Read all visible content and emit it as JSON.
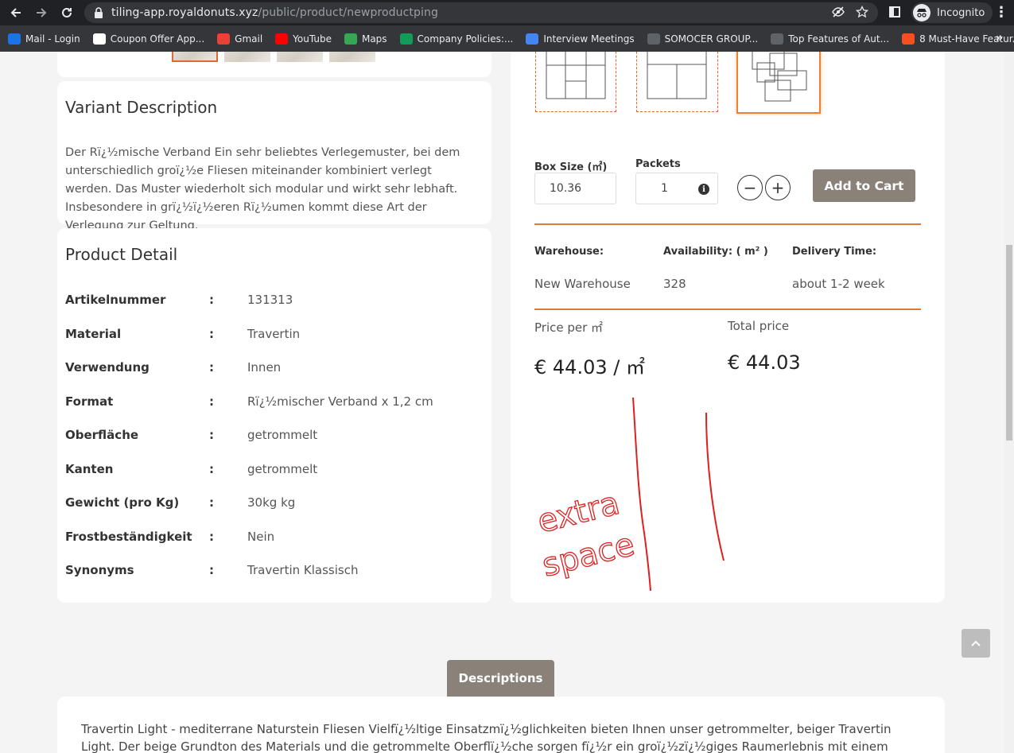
{
  "browser": {
    "url_host": "tiling-app.royaldonuts.xyz",
    "url_path": "/public/product/newproductping",
    "incognito_label": "Incognito"
  },
  "bookmarks": [
    {
      "label": "Mail - Login",
      "color": "#1a73e8"
    },
    {
      "label": "Coupon Offer App...",
      "color": "#ffffff"
    },
    {
      "label": "Gmail",
      "color": "#ea4335"
    },
    {
      "label": "YouTube",
      "color": "#ff0000"
    },
    {
      "label": "Maps",
      "color": "#34a853"
    },
    {
      "label": "Company Policies:...",
      "color": "#0f9d58"
    },
    {
      "label": "Interview Meetings",
      "color": "#4285f4"
    },
    {
      "label": "SOMOCER GROUP...",
      "color": "#5f6368"
    },
    {
      "label": "Top Features of Aut...",
      "color": "#5f6368"
    },
    {
      "label": "8 Must-Have Featur...",
      "color": "#f4511e"
    }
  ],
  "variant": {
    "title": "Variant Description",
    "text": "Der Rï¿½mische Verband Ein sehr beliebtes Verlegemuster, bei dem unterschiedlich groï¿½e Fliesen miteinander kombiniert verlegt werden. Das Muster wiederholt sich modular und wirkt sehr lebhaft. Insbesondere in grï¿½ï¿½eren Rï¿½umen kommt diese Art der Verlegung zur Geltung."
  },
  "detail": {
    "title": "Product Detail",
    "rows": [
      {
        "key": "Artikelnummer",
        "value": "131313"
      },
      {
        "key": "Material",
        "value": "Travertin"
      },
      {
        "key": "Verwendung",
        "value": "Innen"
      },
      {
        "key": "Format",
        "value": "Rï¿½mischer Verband x 1,2 cm"
      },
      {
        "key": "Oberfläche",
        "value": "getrommelt"
      },
      {
        "key": "Kanten",
        "value": "getrommelt"
      },
      {
        "key": "Gewicht (pro Kg)",
        "value": "30kg kg"
      },
      {
        "key": "Frostbeständigkeit",
        "value": "Nein"
      },
      {
        "key": "Synonyms",
        "value": "Travertin Klassisch"
      }
    ],
    "separator": ":"
  },
  "purchase": {
    "box_size_label": "Box Size (㎡)",
    "box_size_value": "10.36",
    "packets_label": "Packets",
    "packets_value": "1",
    "minus": "−",
    "plus": "+",
    "add_to_cart": "Add to Cart"
  },
  "stock": {
    "warehouse_label": "Warehouse:",
    "availability_label": "Availability: ( m² )",
    "delivery_label": "Delivery Time:",
    "warehouse_value": "New Warehouse",
    "availability_value": "328",
    "delivery_value": "about 1-2 week"
  },
  "pricing": {
    "per_label": "Price per ㎡",
    "total_label": "Total price",
    "per_value": "€ 44.03 / ㎡",
    "total_value": "€ 44.03"
  },
  "annotation": {
    "handwritten": "extra space",
    "color": "#e02020"
  },
  "descriptions": {
    "tab_label": "Descriptions",
    "text": "Travertin Light - mediterrane Naturstein Fliesen Vielfï¿½ltige Einsatzmï¿½glichkeiten bieten Ihnen unser getrommelter, beiger Travertin Light. Der beige Grundton des Materials und die getrommelte Oberflï¿½che sorgen fï¿½r ein groï¿½zï¿½giges Raumerlebnis mit einem Hauch Mittelmeer. Tï¿½rkischer"
  },
  "colors": {
    "accent": "#e07a30",
    "button": "#8a8279"
  }
}
